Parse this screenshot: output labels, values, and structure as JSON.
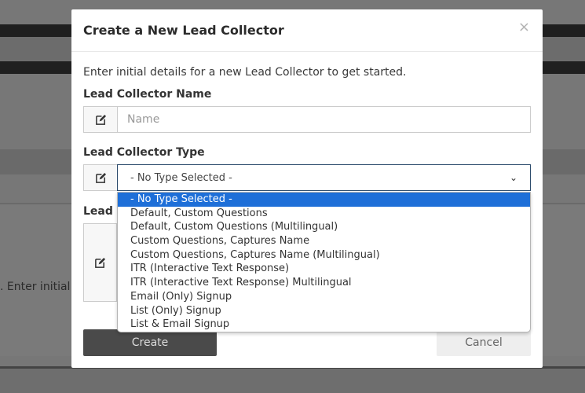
{
  "modal": {
    "title": "Create a New Lead Collector",
    "close_label": "×",
    "intro": "Enter initial details for a new Lead Collector to get started.",
    "name_label": "Lead Collector Name",
    "name_placeholder": "Name",
    "type_label": "Lead Collector Type",
    "type_selected": "- No Type Selected -",
    "partial_label": "Lead C",
    "create_label": "Create",
    "cancel_label": "Cancel"
  },
  "background": {
    "partial_text": ". Enter initial d"
  },
  "type_options": [
    "- No Type Selected -",
    "Default, Custom Questions",
    "Default, Custom Questions (Multilingual)",
    "Custom Questions, Captures Name",
    "Custom Questions, Captures Name (Multilingual)",
    "ITR (Interactive Text Response)",
    "ITR (Interactive Text Response) Multilingual",
    "Email (Only) Signup",
    "List (Only) Signup",
    "List & Email Signup"
  ],
  "colors": {
    "selected_option": "#1e6fd8",
    "create_button": "#4a4a4a"
  }
}
